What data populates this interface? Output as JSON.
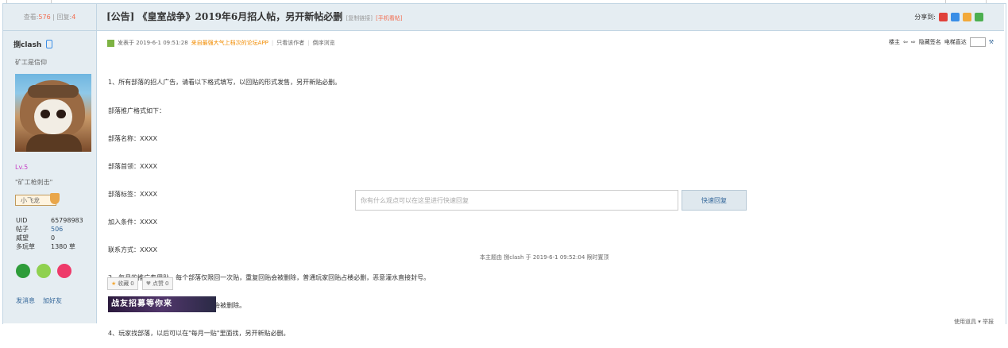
{
  "header": {
    "stats_views_label": "查看:",
    "stats_views": "576",
    "stats_sep": "|",
    "stats_replies_label": "回复:",
    "stats_replies": "4",
    "title": "[公告] 《皇室战争》2019年6月招人帖，另开新帖必删",
    "copy_link": "[复制链接]",
    "mobile_post": "[手机看帖]",
    "share_label": "分享到:"
  },
  "author": {
    "name": "捌clash",
    "title": "矿工是信仰",
    "level": "Lv.5",
    "motto": "\"矿工枪刺击\"",
    "badge": "小飞龙",
    "info": [
      {
        "k": "UID",
        "v": "65798983"
      },
      {
        "k": "帖子",
        "v": "506"
      },
      {
        "k": "威望",
        "v": "0"
      },
      {
        "k": "多玩草",
        "v": "1380 草"
      }
    ],
    "send_message": "发消息",
    "add_friend": "加好友"
  },
  "post": {
    "posted_at": "发表于 2019-6-1 09:51:28",
    "from_app": "来自最强大气上档次的论坛APP",
    "only_author": "只看该作者",
    "reverse": "倒序浏览",
    "right_label": "楼主",
    "hide_sig": "隐藏签名",
    "goto_floor": "电梯直达",
    "lines": [
      "1、所有部落的招人广告，请看以下格式填写，以回贴的形式发售，另开新贴必删。",
      "部落推广格式如下：",
      "部落名称：XXXX",
      "部落首领：XXXX",
      "部落标签：XXXX",
      "加入条件：XXXX",
      "联系方式：XXXX",
      "2、每月的推广专用贴，每个部落仅限回一次贴，重复回贴会被删除，普通玩家回贴占楼必删，恶意灌水直接封号。",
      "3、每楼最多只能贴一个图，多贴图的会被删除。",
      "4、玩家找部落，以后可以在\"每月一贴\"里面找，另开新贴必删。"
    ],
    "quick_placeholder": "你有什么观点可以在这里进行快速回复",
    "quick_button": "快速回复",
    "edited": "本主题由 捌clash 于 2019-6-1 09:52:04 限时置顶",
    "favorite": "收藏",
    "favorite_count": "0",
    "like": "点赞",
    "like_count": "0",
    "banner": "战友招募等你来",
    "bottom_right": "使用道具 ▾  举报"
  },
  "colors": {
    "header_bg": "#e5edf2",
    "border": "#c2d5e3",
    "accent_red": "#f26c4f",
    "link": "#336699",
    "level": "#c63fc6"
  }
}
